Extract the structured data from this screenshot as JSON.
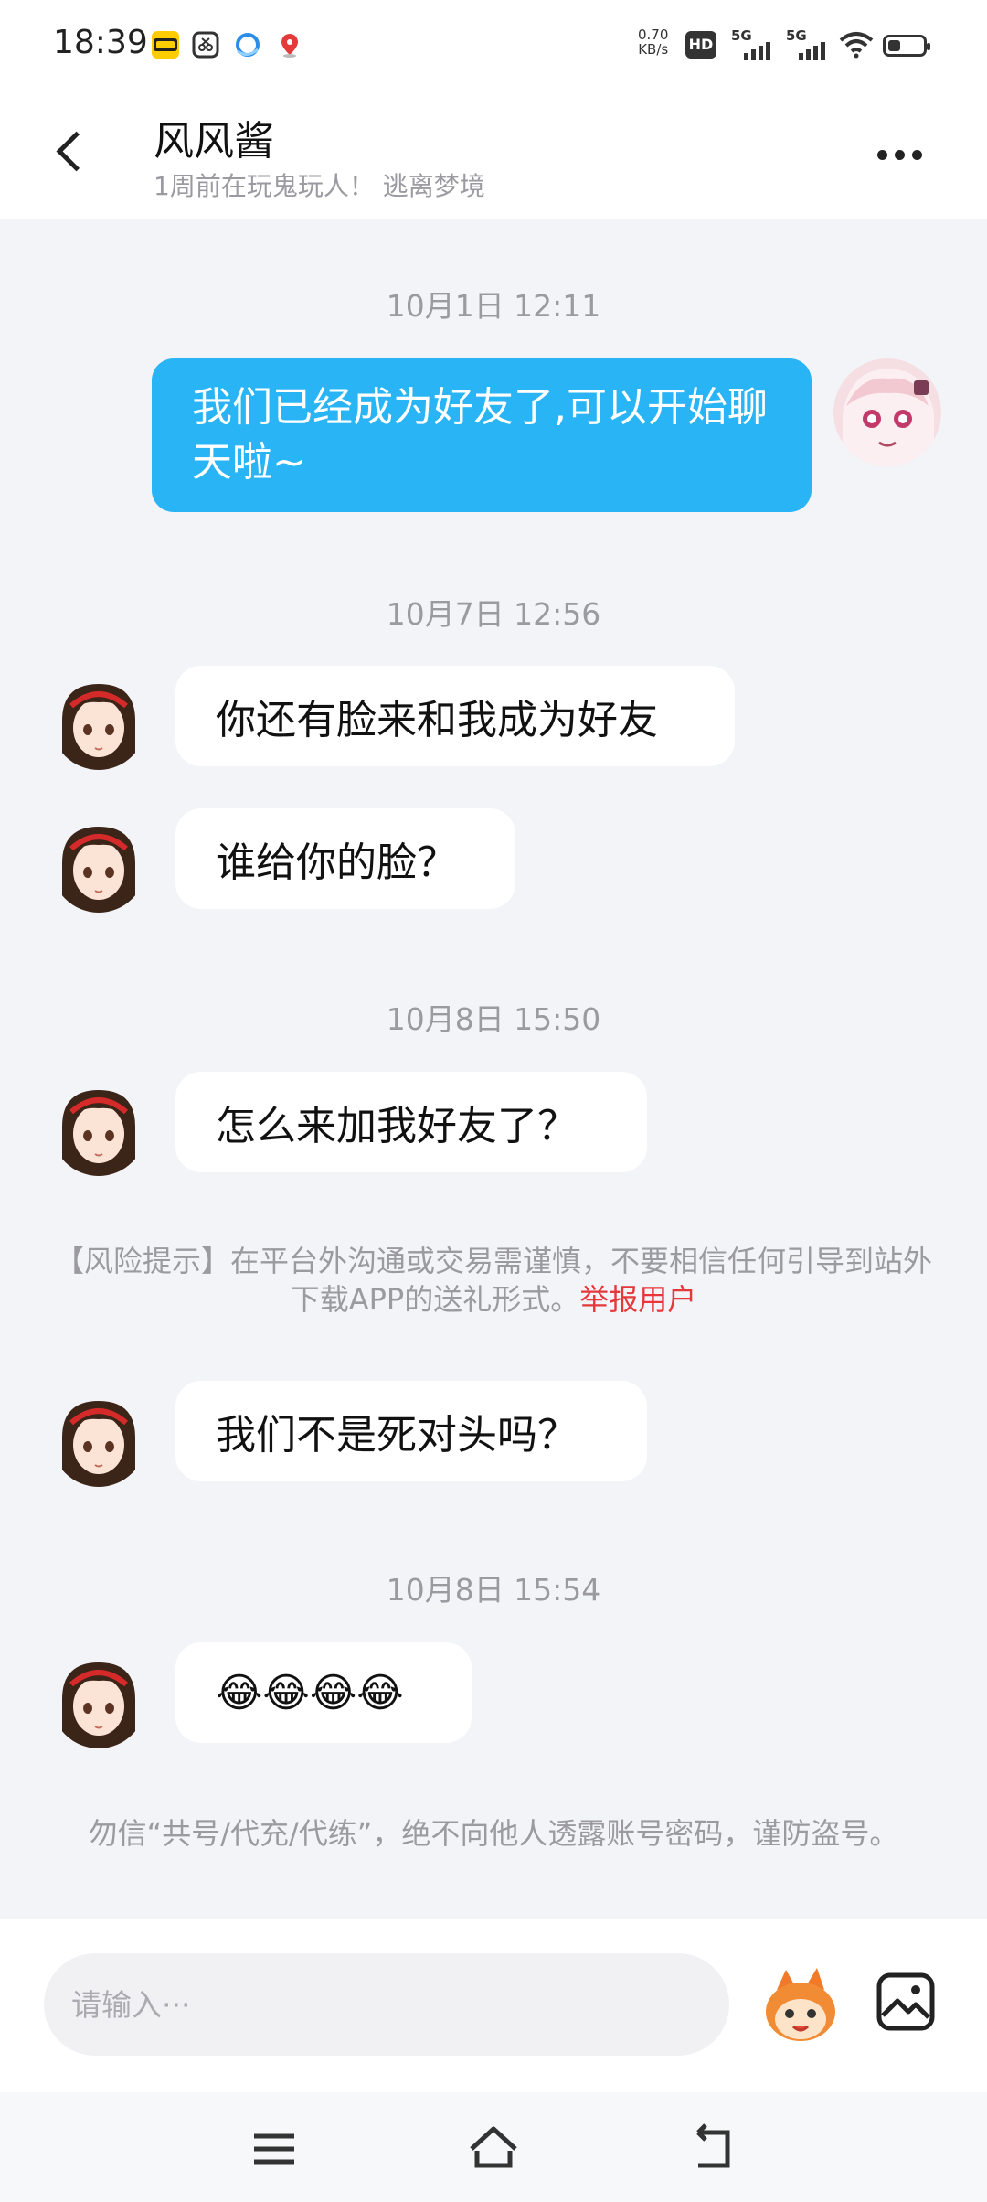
{
  "status_bar": {
    "time": "18:39",
    "net_speed_value": "0.70",
    "net_speed_unit": "KB/s",
    "hd_label": "HD",
    "sim1_label": "5G",
    "sim2_label": "5G",
    "battery_level": 0.35
  },
  "header": {
    "name": "风风酱",
    "status": "1周前在玩鬼玩人！ 逃离梦境"
  },
  "chat": {
    "ts1": "10月1日 12:11",
    "msg_out_1": "我们已经成为好友了,可以开始聊天啦~",
    "ts2": "10月7日 12:56",
    "msg_in_1": "你还有脸来和我成为好友",
    "msg_in_2": "谁给你的脸？",
    "ts3": "10月8日 15:50",
    "msg_in_3": "怎么来加我好友了？",
    "risk_notice": "【风险提示】在平台外沟通或交易需谨慎，不要相信任何引导到站外下载APP的送礼形式。",
    "report_link": "举报用户",
    "msg_in_4": "我们不是死对头吗？",
    "ts4": "10月8日 15:54",
    "msg_in_5": "😂😂😂😂",
    "safety_notice": "勿信“共号/代充/代练”，绝不向他人透露账号密码，谨防盗号。"
  },
  "input": {
    "placeholder": "请输入···"
  },
  "icons": {
    "back": "back-arrow-icon",
    "more": "more-dots-icon",
    "mascot": "mascot-emoji-icon",
    "image": "image-icon",
    "nav_menu": "menu-icon",
    "nav_home": "home-icon",
    "nav_back": "back-nav-icon"
  },
  "colors": {
    "accent": "#29b4f5",
    "report": "#e5383b"
  }
}
